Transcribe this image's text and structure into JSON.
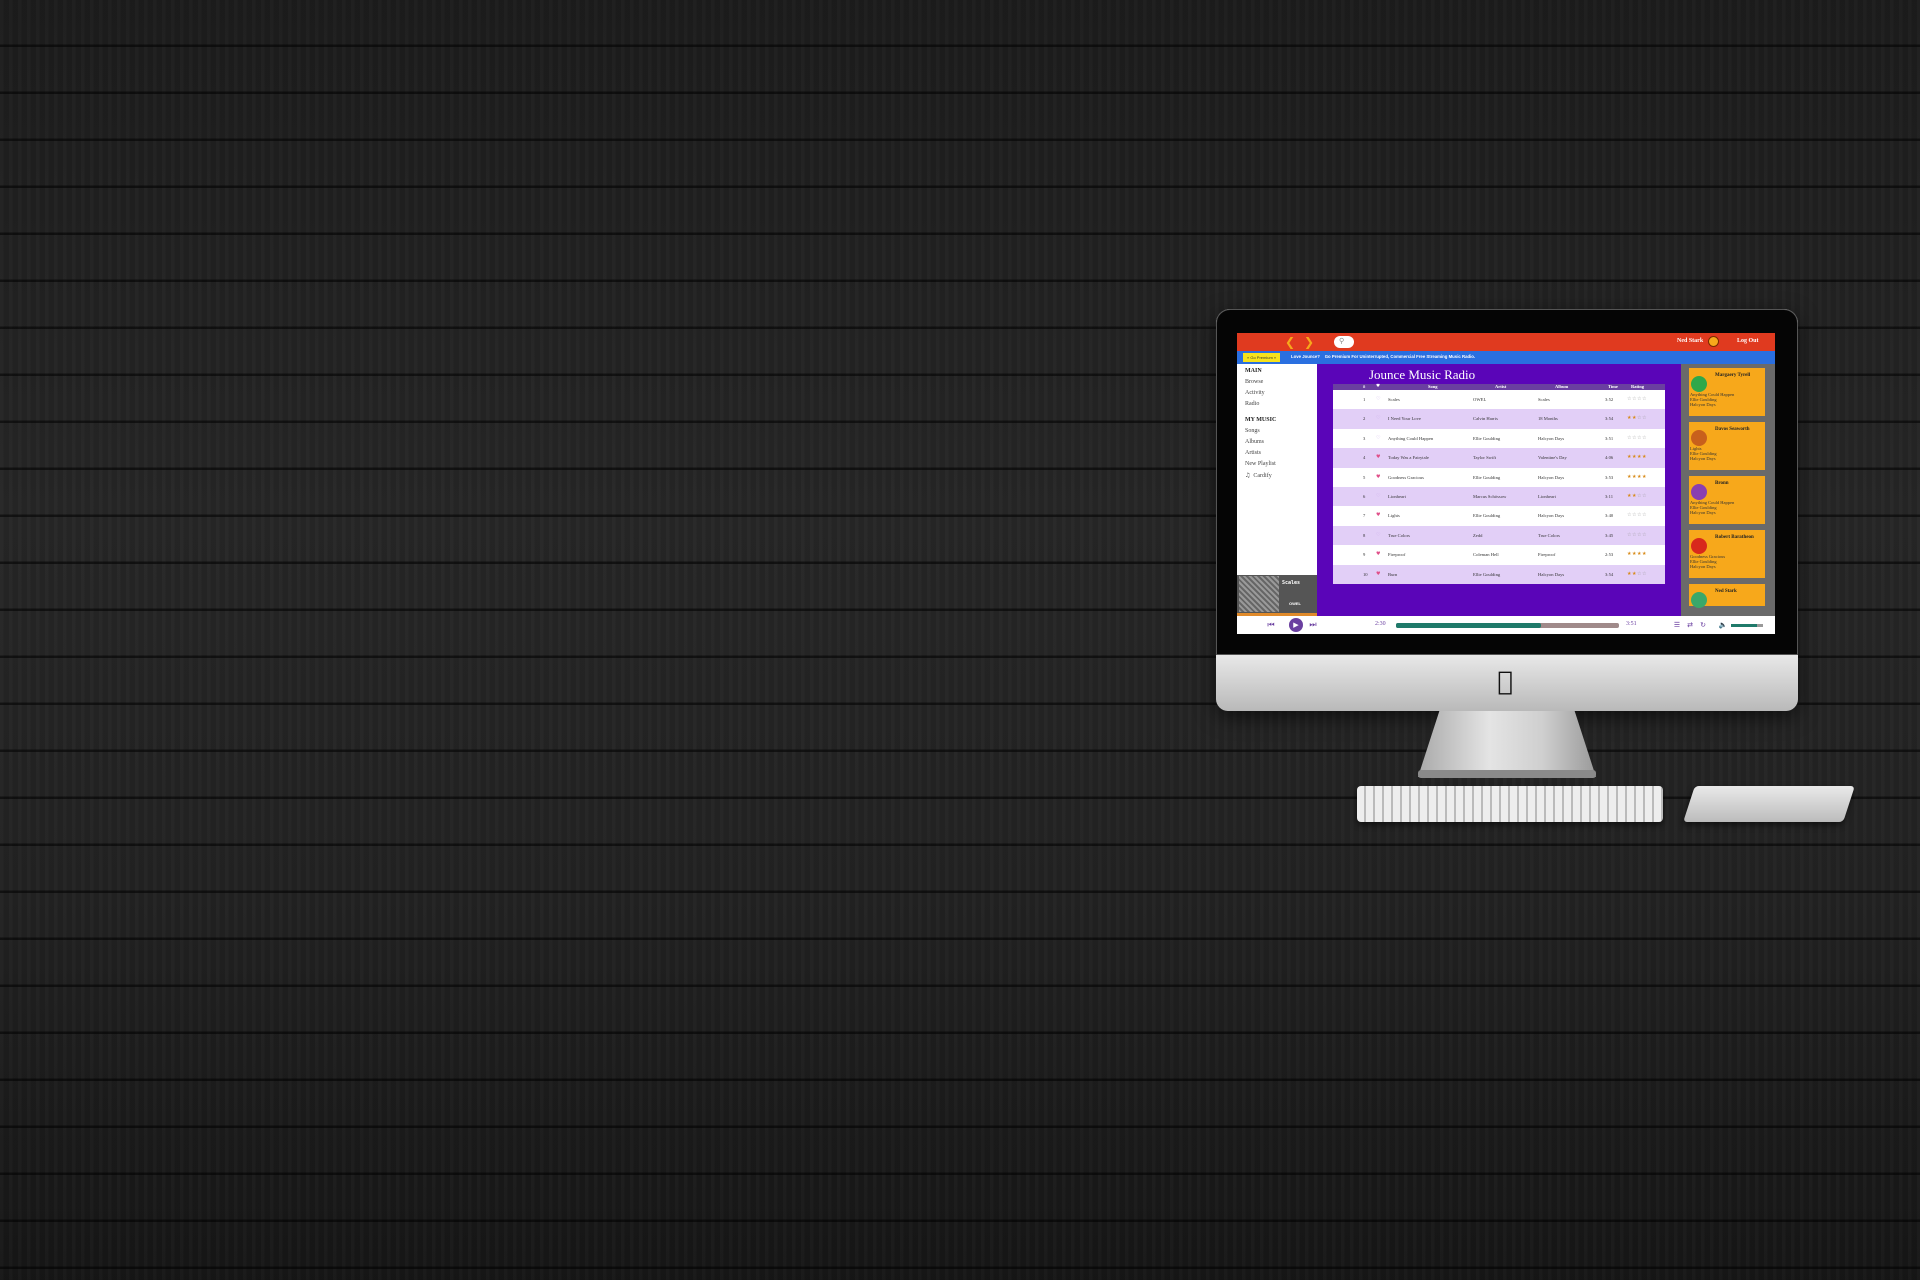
{
  "topbar": {
    "back_icon": "chevron-left-icon",
    "forward_icon": "chevron-right-icon",
    "search_icon": "search-icon",
    "user_name": "Ned Stark",
    "logout_label": "Log Out"
  },
  "banner": {
    "premium_button": "» Go Premium «",
    "text_strong": "Love Jounce?",
    "text": "Go Premium For Uninterrupted, Commercial Free Streaming Music Radio."
  },
  "sidebar": {
    "main_heading": "MAIN",
    "main_items": [
      "Browse",
      "Activity",
      "Radio"
    ],
    "mymusic_heading": "MY MUSIC",
    "mymusic_items": [
      "Songs",
      "Albums",
      "Artists",
      "New Playlist",
      "Cardify"
    ]
  },
  "now_playing": {
    "title": "Scales",
    "artist": "OWEL"
  },
  "main": {
    "title": "Jounce Music Radio",
    "columns": [
      "#",
      "♥",
      "Song",
      "Artist",
      "Album",
      "Time",
      "Rating"
    ],
    "rows": [
      {
        "num": "1",
        "liked": false,
        "song": "Scales",
        "artist": "OWEL",
        "album": "Scales",
        "time": "3:52",
        "rating": 0
      },
      {
        "num": "2",
        "liked": false,
        "song": "I Need Your Love",
        "artist": "Calvin Harris",
        "album": "18 Months",
        "time": "3:54",
        "rating": 2
      },
      {
        "num": "3",
        "liked": false,
        "song": "Anything Could Happen",
        "artist": "Ellie Goulding",
        "album": "Halcyon Days",
        "time": "3:51",
        "rating": 0
      },
      {
        "num": "4",
        "liked": true,
        "song": "Today Was a Fairytale",
        "artist": "Taylor Swift",
        "album": "Valentine's Day",
        "time": "4:06",
        "rating": 4
      },
      {
        "num": "5",
        "liked": true,
        "song": "Goodness Gracious",
        "artist": "Ellie Goulding",
        "album": "Halcyon Days",
        "time": "3:53",
        "rating": 4
      },
      {
        "num": "6",
        "liked": false,
        "song": "Lionheart",
        "artist": "Marcus Schössow",
        "album": "Lionheart",
        "time": "3:11",
        "rating": 2
      },
      {
        "num": "7",
        "liked": true,
        "song": "Lights",
        "artist": "Ellie Goulding",
        "album": "Halcyon Days",
        "time": "3:40",
        "rating": 0
      },
      {
        "num": "8",
        "liked": false,
        "song": "True Colors",
        "artist": "Zedd",
        "album": "True Colors",
        "time": "3:45",
        "rating": 0
      },
      {
        "num": "9",
        "liked": true,
        "song": "Fireproof",
        "artist": "Coleman Hell",
        "album": "Fireproof",
        "time": "2:53",
        "rating": 4
      },
      {
        "num": "10",
        "liked": true,
        "song": "Burn",
        "artist": "Ellie Goulding",
        "album": "Halcyon Days",
        "time": "3:54",
        "rating": 2
      }
    ]
  },
  "friends": [
    {
      "name": "Margaery Tyrell",
      "song": "Anything Could Happen",
      "artist": "Ellie Goulding",
      "album": "Halcyon Days",
      "avatar_color": "#2fa84a"
    },
    {
      "name": "Davos Seaworth",
      "song": "Lights",
      "artist": "Ellie Goulding",
      "album": "Halcyon Days",
      "avatar_color": "#c8601c"
    },
    {
      "name": "Bronn",
      "song": "Anything Could Happen",
      "artist": "Ellie Goulding",
      "album": "Halcyon Days",
      "avatar_color": "#8a3fb0"
    },
    {
      "name": "Robert Baratheon",
      "song": "Goodness Gracious",
      "artist": "Ellie Goulding",
      "album": "Halcyon Days",
      "avatar_color": "#d8281c"
    },
    {
      "name": "Ned Stark",
      "song": "",
      "artist": "",
      "album": "",
      "avatar_color": "#3aa86a"
    }
  ],
  "player": {
    "current_time": "2:30",
    "total_time": "3:51",
    "progress_fraction": 0.65,
    "volume_fraction": 0.8,
    "prev_icon": "skip-back-icon",
    "play_icon": "play-icon",
    "next_icon": "skip-forward-icon",
    "queue_icon": "list-icon",
    "shuffle_icon": "shuffle-icon",
    "repeat_icon": "repeat-icon",
    "volume_icon": "volume-icon"
  },
  "colors": {
    "topbar": "#e03a1f",
    "banner": "#2a6fe0",
    "main_bg": "#5a05b8",
    "row_alt": "#e2cff7",
    "friend_card": "#f7a81b",
    "accent": "#6a3fa0"
  }
}
